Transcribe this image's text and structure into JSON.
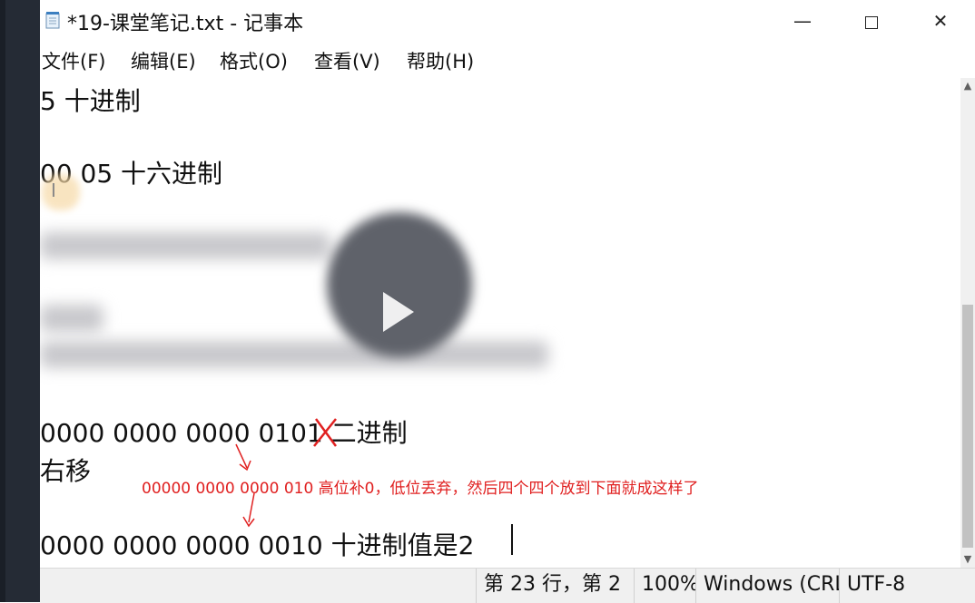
{
  "window": {
    "title": "*19-课堂笔记.txt - 记事本",
    "minimize_glyph": "—",
    "close_glyph": "✕"
  },
  "menu": [
    {
      "label": "文件(F)"
    },
    {
      "label": "编辑(E)"
    },
    {
      "label": "格式(O)"
    },
    {
      "label": "查看(V)"
    },
    {
      "label": "帮助(H)"
    }
  ],
  "editor": {
    "lines": [
      "5  十进制",
      "00 05  十六进制",
      "0000 0000 0000 0101  二进制",
      "右移",
      "0000 0000 0000 0010  十进制值是2"
    ],
    "annotation": "00000 0000 0000 010    高位补0，低位丢弃，然后四个四个放到下面就成这样了"
  },
  "status": {
    "position": "第 23 行，第 2",
    "zoom": "100%",
    "line_ending": "Windows (CRLF)",
    "encoding": "UTF-8"
  },
  "colors": {
    "annotation": "#e02020",
    "sidebar": "#252b35"
  },
  "icons": {
    "app": "notepad-icon",
    "scroll_up": "chevron-up-icon",
    "scroll_down": "chevron-down-icon"
  }
}
